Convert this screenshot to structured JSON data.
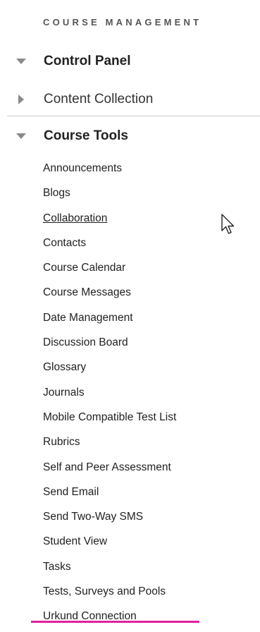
{
  "sidebar": {
    "heading": "COURSE MANAGEMENT",
    "sections": {
      "control_panel": {
        "label": "Control Panel",
        "state": "expanded"
      },
      "content_collection": {
        "label": "Content Collection",
        "state": "collapsed"
      },
      "course_tools": {
        "label": "Course Tools",
        "state": "expanded"
      }
    },
    "tools": [
      "Announcements",
      "Blogs",
      "Collaboration",
      "Contacts",
      "Course Calendar",
      "Course Messages",
      "Date Management",
      "Discussion Board",
      "Glossary",
      "Journals",
      "Mobile Compatible Test List",
      "Rubrics",
      "Self and Peer Assessment",
      "Send Email",
      "Send Two-Way SMS",
      "Student View",
      "Tasks",
      "Tests, Surveys and Pools",
      "Urkund Connection"
    ],
    "hovered_tool": "Collaboration",
    "highlighted_tool": "Urkund Connection"
  },
  "colors": {
    "highlight": "#e0219c",
    "triangle": "#8a8a8a",
    "divider": "#cfcfcf"
  },
  "icons": {
    "expanded": "triangle-down-icon",
    "collapsed": "triangle-right-icon",
    "cursor": "mouse-pointer-icon"
  }
}
